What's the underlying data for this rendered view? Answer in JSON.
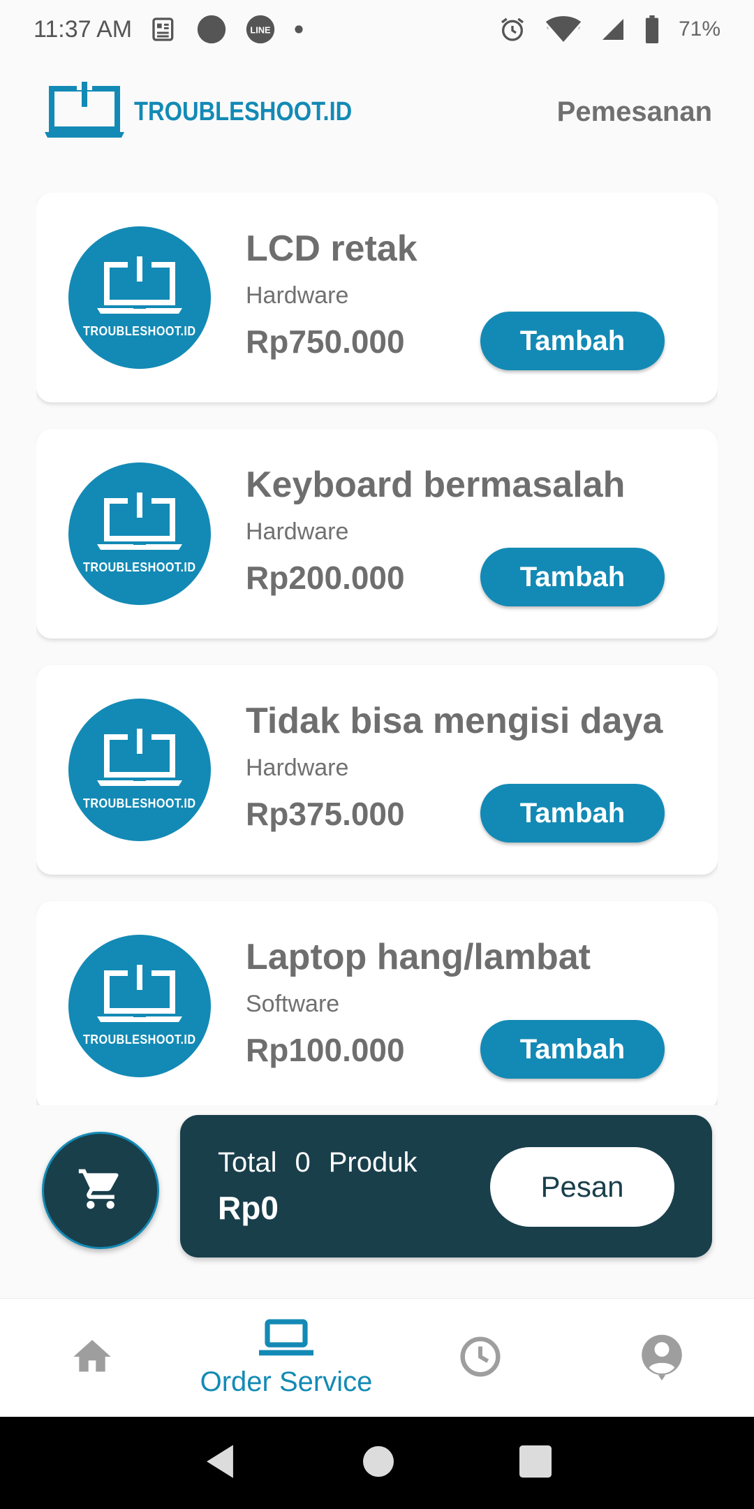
{
  "status_bar": {
    "time": "11:37 AM",
    "battery": "71%",
    "left_icons": [
      "news-icon",
      "circle-notification-icon",
      "line-app-icon",
      "dot-icon"
    ],
    "right_icons": [
      "alarm-icon",
      "wifi-icon",
      "signal-icon",
      "battery-icon"
    ]
  },
  "header": {
    "brand": "TROUBLESHOOT.ID",
    "action": "Pemesanan"
  },
  "products": [
    {
      "title": "LCD retak",
      "category": "Hardware",
      "price": "Rp750.000",
      "button": "Tambah",
      "logo_text": "TROUBLESHOOT.ID"
    },
    {
      "title": "Keyboard bermasalah",
      "category": "Hardware",
      "price": "Rp200.000",
      "button": "Tambah",
      "logo_text": "TROUBLESHOOT.ID"
    },
    {
      "title": "Tidak bisa mengisi daya",
      "category": "Hardware",
      "price": "Rp375.000",
      "button": "Tambah",
      "logo_text": "TROUBLESHOOT.ID"
    },
    {
      "title": "Laptop hang/lambat",
      "category": "Software",
      "price": "Rp100.000",
      "button": "Tambah",
      "logo_text": "TROUBLESHOOT.ID"
    }
  ],
  "cart": {
    "summary_prefix": "Total",
    "count": "0",
    "summary_suffix": "Produk",
    "total": "Rp0",
    "order_button": "Pesan"
  },
  "bottom_nav": {
    "items": [
      {
        "icon": "home-icon",
        "label": ""
      },
      {
        "icon": "laptop-icon",
        "label": "Order Service",
        "active": true
      },
      {
        "icon": "clock-icon",
        "label": ""
      },
      {
        "icon": "account-icon",
        "label": ""
      }
    ]
  },
  "colors": {
    "primary": "#138ab5",
    "dark": "#193f4b",
    "text_gray": "#707070",
    "inactive_icon": "#9e9e9e"
  }
}
